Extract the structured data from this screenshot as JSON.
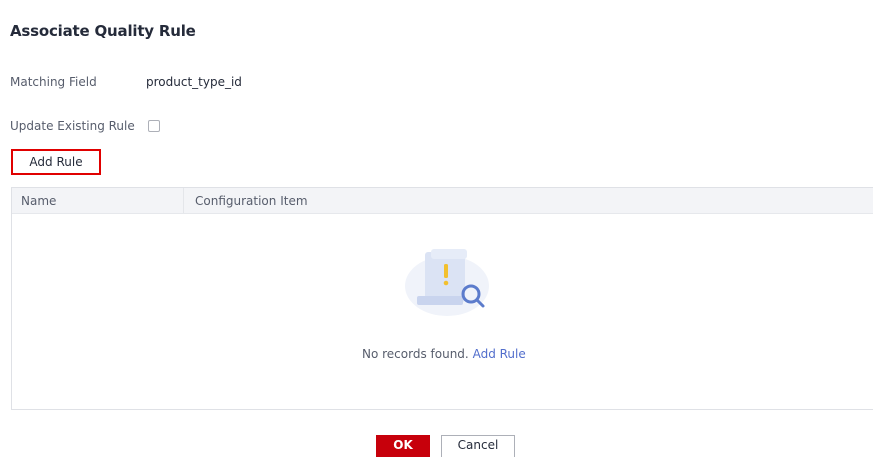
{
  "dialog": {
    "title": "Associate Quality Rule"
  },
  "form": {
    "matching_field_label": "Matching Field",
    "matching_field_value": "product_type_id",
    "update_existing_label": "Update Existing Rule",
    "update_existing_checked": false
  },
  "toolbar": {
    "add_rule_label": "Add Rule"
  },
  "table": {
    "columns": [
      "Name",
      "Configuration Item"
    ],
    "rows": [],
    "empty_text": "No records found.",
    "empty_link": "Add Rule",
    "empty_icon": "document-search-icon"
  },
  "footer": {
    "ok_label": "OK",
    "cancel_label": "Cancel"
  },
  "colors": {
    "primary": "#c7000b",
    "highlight_border": "#e00000",
    "link": "#526ecc",
    "header_bg": "#f3f4f7"
  }
}
